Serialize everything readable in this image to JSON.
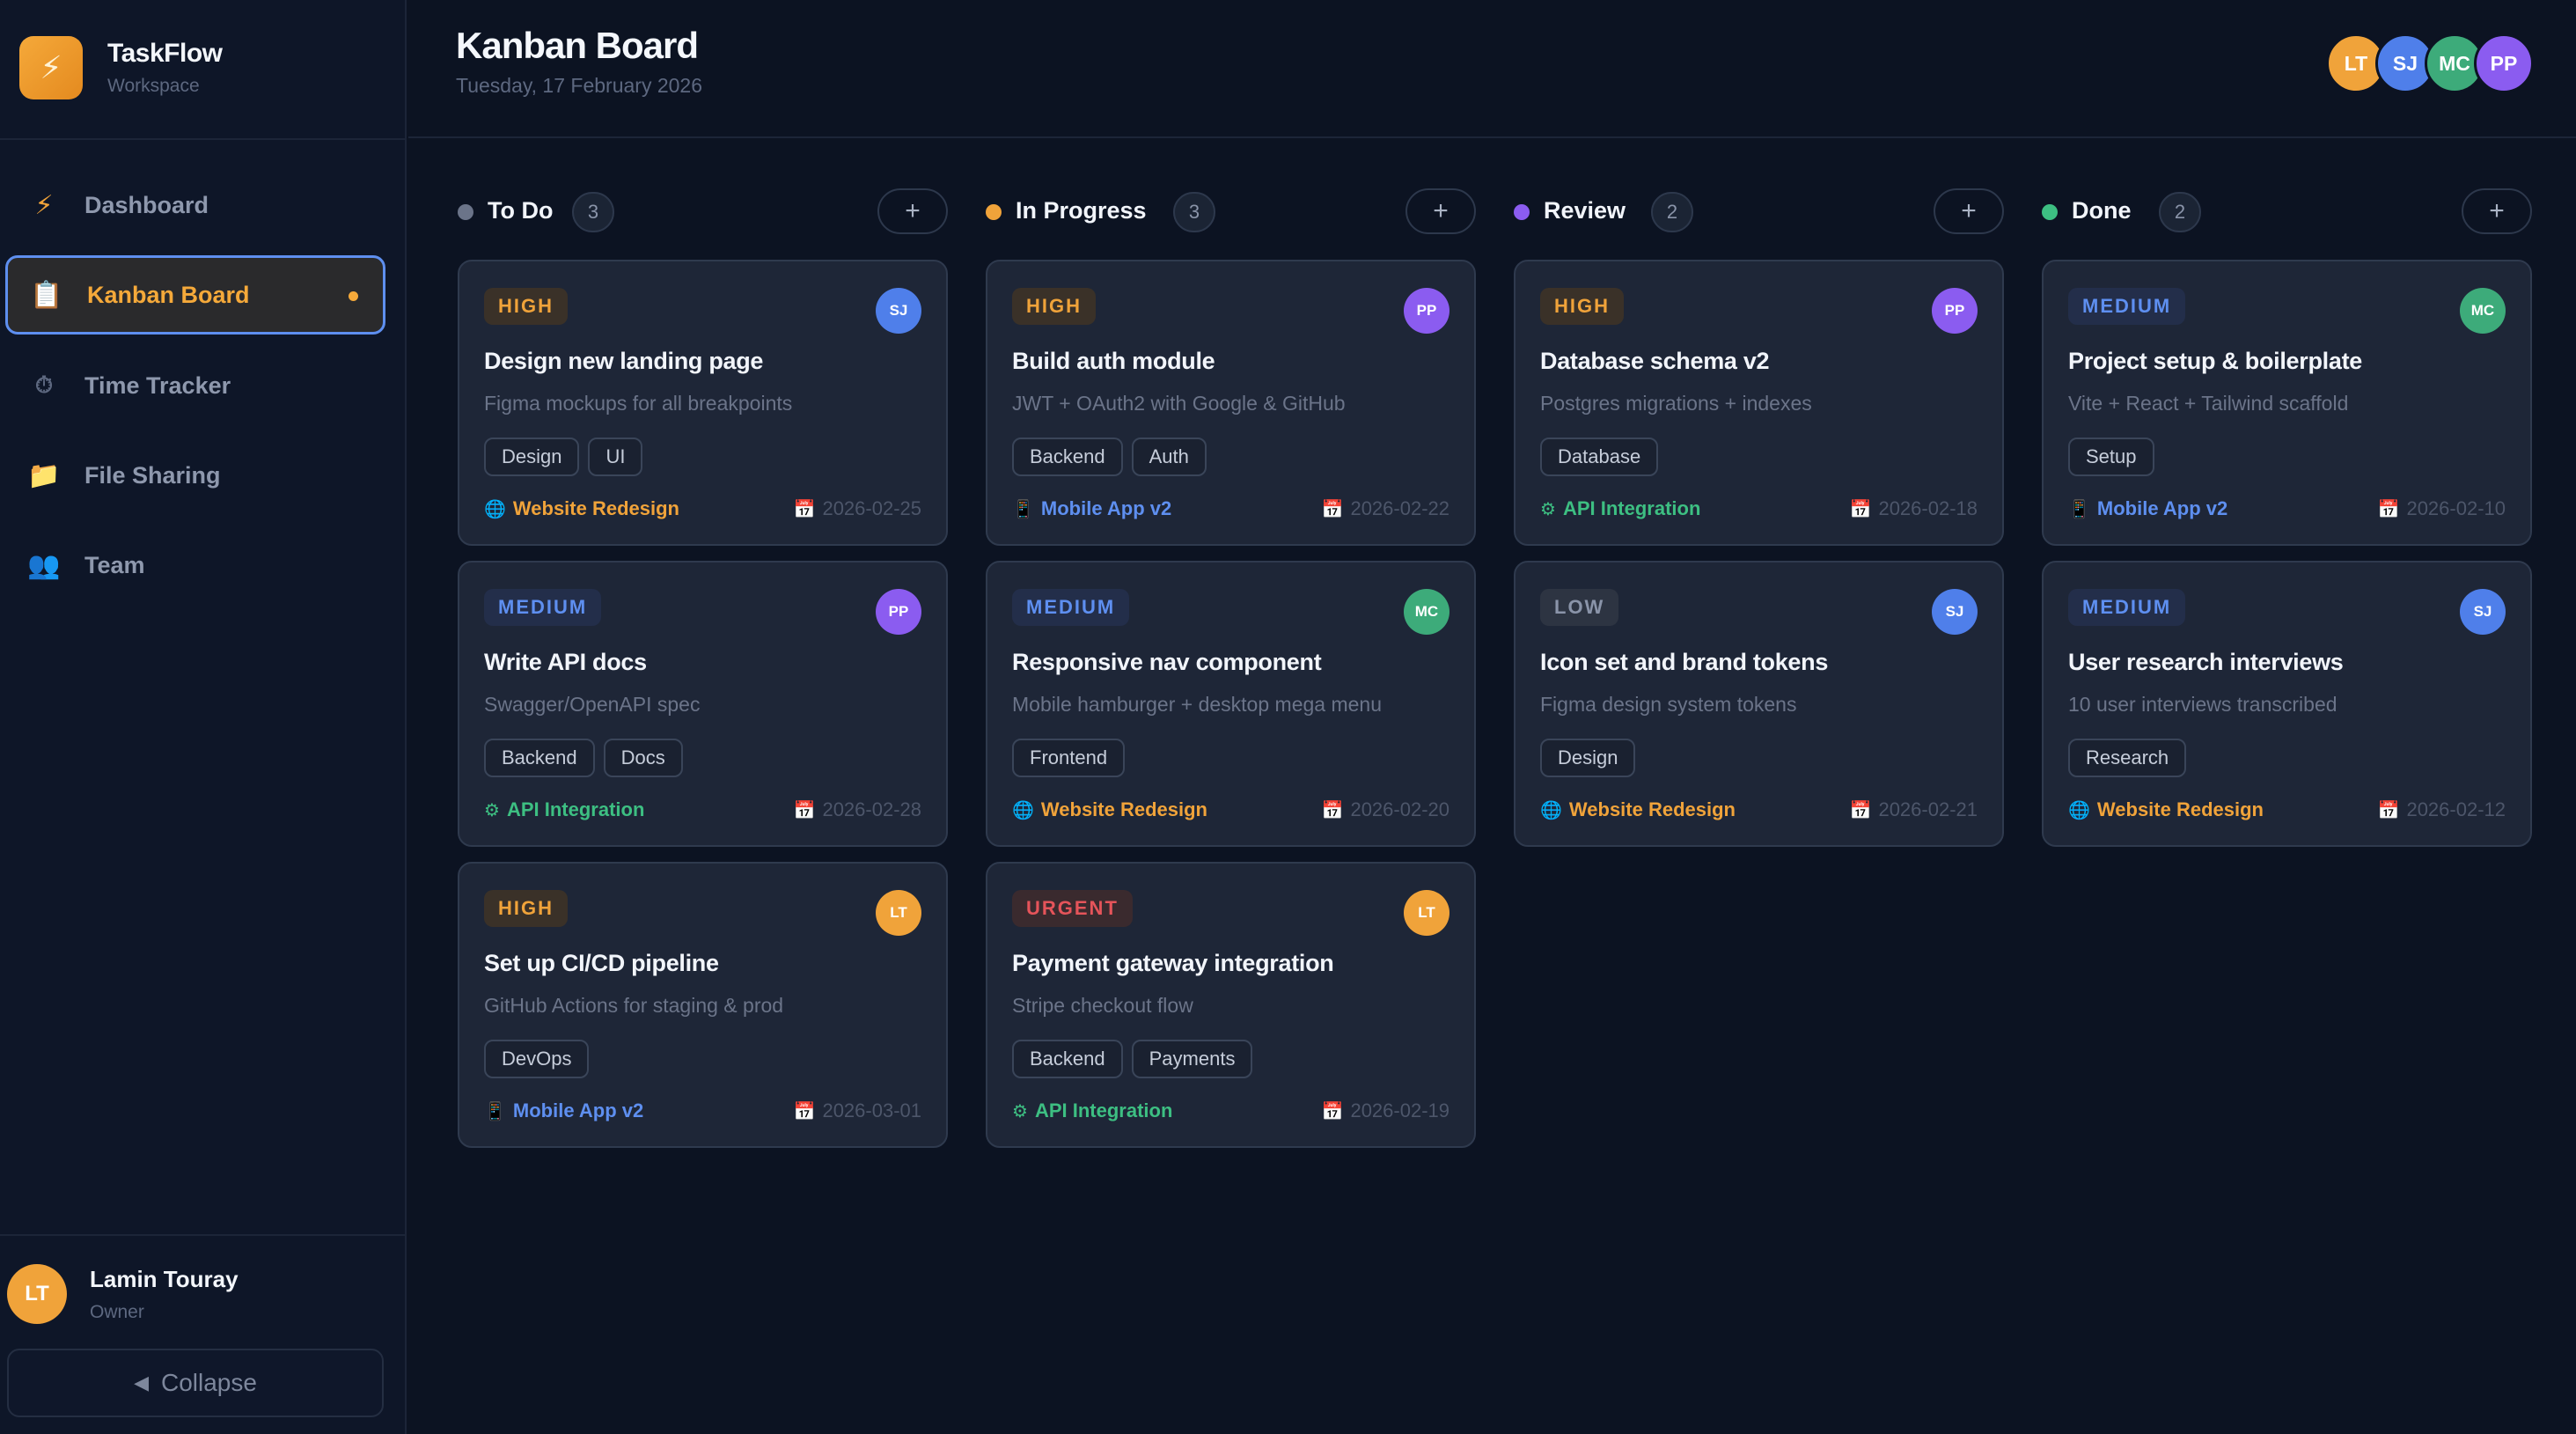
{
  "sidebar": {
    "brand": {
      "name": "TaskFlow",
      "sub": "Workspace",
      "logo_icon": "⚡"
    },
    "nav": [
      {
        "label": "Dashboard",
        "icon": "⚡",
        "icon_name": "lightning-icon"
      },
      {
        "label": "Kanban Board",
        "icon": "📋",
        "icon_name": "clipboard-icon"
      },
      {
        "label": "Time Tracker",
        "icon": "⏱",
        "icon_name": "stopwatch-icon"
      },
      {
        "label": "File Sharing",
        "icon": "📁",
        "icon_name": "folder-icon"
      },
      {
        "label": "Team",
        "icon": "👥",
        "icon_name": "people-icon"
      }
    ],
    "user": {
      "initials": "LT",
      "name": "Lamin Touray",
      "role": "Owner"
    },
    "collapse_label": "Collapse",
    "collapse_icon": "◀"
  },
  "header": {
    "title": "Kanban Board",
    "date": "Tuesday, 17 February 2026",
    "team": [
      "LT",
      "SJ",
      "MC",
      "PP"
    ]
  },
  "colors": {
    "todo": "#6b7489",
    "progress": "#f0a33a",
    "review": "#8b5cf0",
    "done": "#3dbf82",
    "accent": "#5e8ff0"
  },
  "columns": [
    {
      "title": "To Do",
      "count": "3",
      "add": "+",
      "cards": [
        {
          "priority": "HIGH",
          "assignee": "SJ",
          "title": "Design new landing page",
          "desc": "Figma mockups for all breakpoints",
          "tags": [
            "Design",
            "UI"
          ],
          "project": "Website Redesign",
          "project_icon": "🌐",
          "due": "2026-02-25"
        },
        {
          "priority": "MEDIUM",
          "assignee": "PP",
          "title": "Write API docs",
          "desc": "Swagger/OpenAPI spec",
          "tags": [
            "Backend",
            "Docs"
          ],
          "project": "API Integration",
          "project_icon": "⚙",
          "due": "2026-02-28"
        },
        {
          "priority": "HIGH",
          "assignee": "LT",
          "title": "Set up CI/CD pipeline",
          "desc": "GitHub Actions for staging & prod",
          "tags": [
            "DevOps"
          ],
          "project": "Mobile App v2",
          "project_icon": "📱",
          "due": "2026-03-01"
        }
      ]
    },
    {
      "title": "In Progress",
      "count": "3",
      "add": "+",
      "cards": [
        {
          "priority": "HIGH",
          "assignee": "PP",
          "title": "Build auth module",
          "desc": "JWT + OAuth2 with Google & GitHub",
          "tags": [
            "Backend",
            "Auth"
          ],
          "project": "Mobile App v2",
          "project_icon": "📱",
          "due": "2026-02-22"
        },
        {
          "priority": "MEDIUM",
          "assignee": "MC",
          "title": "Responsive nav component",
          "desc": "Mobile hamburger + desktop mega menu",
          "tags": [
            "Frontend"
          ],
          "project": "Website Redesign",
          "project_icon": "🌐",
          "due": "2026-02-20"
        },
        {
          "priority": "URGENT",
          "assignee": "LT",
          "title": "Payment gateway integration",
          "desc": "Stripe checkout flow",
          "tags": [
            "Backend",
            "Payments"
          ],
          "project": "API Integration",
          "project_icon": "⚙",
          "due": "2026-02-19"
        }
      ]
    },
    {
      "title": "Review",
      "count": "2",
      "add": "+",
      "cards": [
        {
          "priority": "HIGH",
          "assignee": "PP",
          "title": "Database schema v2",
          "desc": "Postgres migrations + indexes",
          "tags": [
            "Database"
          ],
          "project": "API Integration",
          "project_icon": "⚙",
          "due": "2026-02-18"
        },
        {
          "priority": "LOW",
          "assignee": "SJ",
          "title": "Icon set and brand tokens",
          "desc": "Figma design system tokens",
          "tags": [
            "Design"
          ],
          "project": "Website Redesign",
          "project_icon": "🌐",
          "due": "2026-02-21"
        }
      ]
    },
    {
      "title": "Done",
      "count": "2",
      "add": "+",
      "cards": [
        {
          "priority": "MEDIUM",
          "assignee": "MC",
          "title": "Project setup & boilerplate",
          "desc": "Vite + React + Tailwind scaffold",
          "tags": [
            "Setup"
          ],
          "project": "Mobile App v2",
          "project_icon": "📱",
          "due": "2026-02-10"
        },
        {
          "priority": "MEDIUM",
          "assignee": "SJ",
          "title": "User research interviews",
          "desc": "10 user interviews transcribed",
          "tags": [
            "Research"
          ],
          "project": "Website Redesign",
          "project_icon": "🌐",
          "due": "2026-02-12"
        }
      ]
    }
  ],
  "calendar_icon": "📅"
}
